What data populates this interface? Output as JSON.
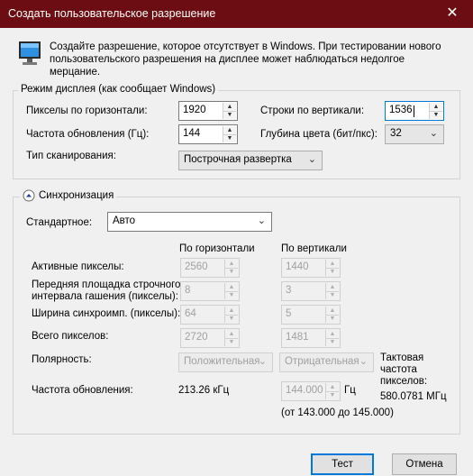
{
  "window": {
    "title": "Создать пользовательское разрешение",
    "close_glyph": "✕"
  },
  "intro": {
    "text": "Создайте разрешение, которое отсутствует в Windows. При тестировании нового пользовательского разрешения на дисплее может наблюдаться недолгое мерцание."
  },
  "display_mode": {
    "legend": "Режим дисплея (как сообщает Windows)",
    "h_pixels_label": "Пикселы по горизонтали:",
    "h_pixels_value": "1920",
    "v_lines_label": "Строки по вертикали:",
    "v_lines_value": "1536",
    "refresh_label": "Частота обновления (Гц):",
    "refresh_value": "144",
    "color_depth_label": "Глубина цвета (бит/пкс):",
    "color_depth_value": "32",
    "scan_label": "Тип сканирования:",
    "scan_value": "Построчная развертка"
  },
  "sync": {
    "legend": "Синхронизация",
    "standard_label": "Стандартное:",
    "standard_value": "Авто",
    "col_h": "По горизонтали",
    "col_v": "По вертикали",
    "rows": [
      {
        "label": "Активные пикселы:",
        "h": "2560",
        "v": "1440"
      },
      {
        "label": "Передняя площадка строчного\nинтервала гашения (пикселы):",
        "h": "8",
        "v": "3"
      },
      {
        "label": "Ширина синхроимп. (пикселы):",
        "h": "64",
        "v": "5"
      },
      {
        "label": "Всего пикселов:",
        "h": "2720",
        "v": "1481"
      }
    ],
    "polarity_label": "Полярность:",
    "polarity_h": "Положительная",
    "polarity_v": "Отрицательная",
    "refresh_label": "Частота обновления:",
    "refresh_h": "213.26 кГц",
    "refresh_v": "144.000",
    "refresh_unit": "Гц",
    "refresh_range": "(от 143.000 до 145.000)",
    "pixel_clock_label": "Тактовая частота пикселов:",
    "pixel_clock_value": "580.0781 МГц"
  },
  "buttons": {
    "test": "Тест",
    "cancel": "Отмена"
  },
  "icons": {
    "monitor": "monitor-icon",
    "collapse": "chevron-up-circle-icon"
  }
}
